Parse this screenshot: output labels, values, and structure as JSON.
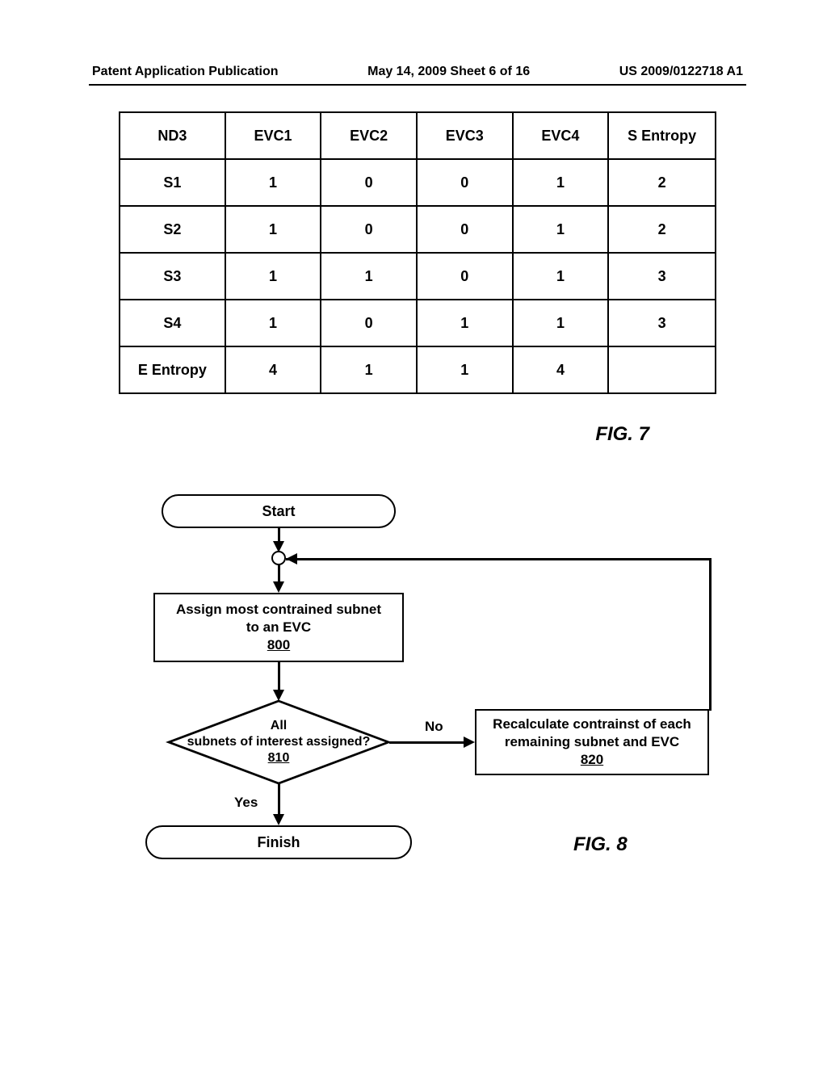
{
  "header": {
    "left": "Patent Application Publication",
    "center": "May 14, 2009  Sheet 6 of 16",
    "right": "US 2009/0122718 A1"
  },
  "chart_data": {
    "type": "table",
    "title": "ND3",
    "columns": [
      "ND3",
      "EVC1",
      "EVC2",
      "EVC3",
      "EVC4",
      "S Entropy"
    ],
    "rows": [
      {
        "label": "S1",
        "values": [
          1,
          0,
          0,
          1,
          2
        ]
      },
      {
        "label": "S2",
        "values": [
          1,
          0,
          0,
          1,
          2
        ]
      },
      {
        "label": "S3",
        "values": [
          1,
          1,
          0,
          1,
          3
        ]
      },
      {
        "label": "S4",
        "values": [
          1,
          0,
          1,
          1,
          3
        ]
      },
      {
        "label": "E Entropy",
        "values": [
          4,
          1,
          1,
          4,
          ""
        ]
      }
    ]
  },
  "figures": {
    "fig7": "FIG. 7",
    "fig8": "FIG. 8"
  },
  "flowchart": {
    "start": "Start",
    "finish": "Finish",
    "step_800": {
      "text_line1": "Assign most contrained subnet",
      "text_line2": "to an EVC",
      "ref": "800"
    },
    "decision_810": {
      "text_line1": "All",
      "text_line2": "subnets of interest assigned?",
      "ref": "810"
    },
    "step_820": {
      "text_line1": "Recalculate contrainst of each",
      "text_line2": "remaining subnet and EVC",
      "ref": "820"
    },
    "label_no": "No",
    "label_yes": "Yes"
  }
}
